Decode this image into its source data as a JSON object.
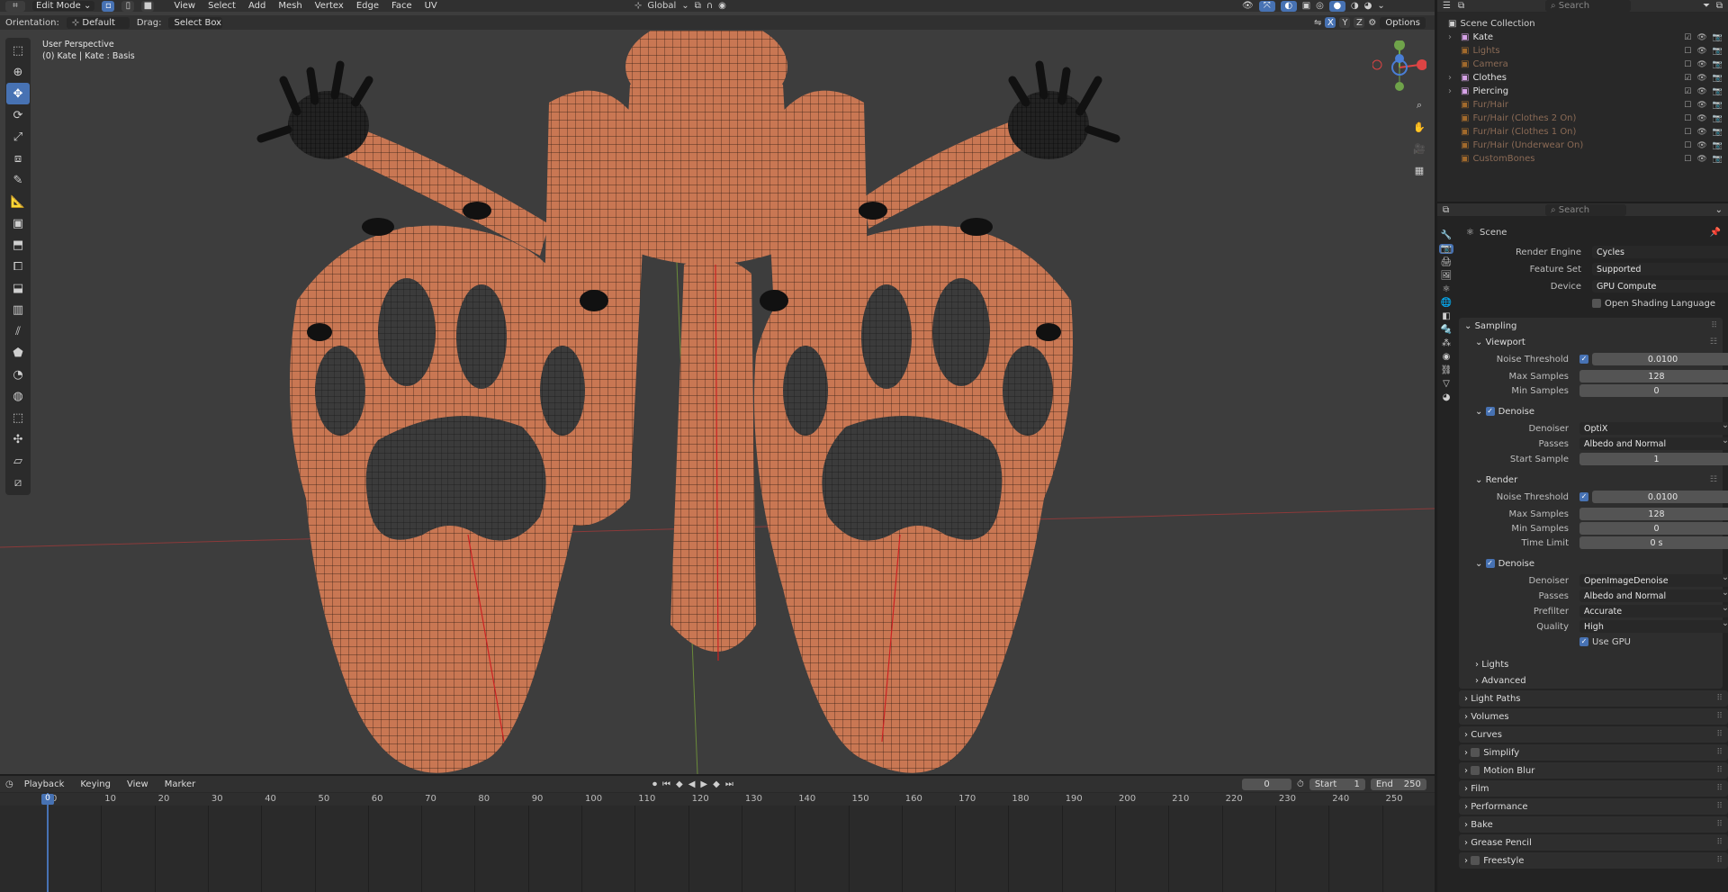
{
  "viewport_header": {
    "mode": "Edit Mode",
    "menus": [
      "View",
      "Select",
      "Add",
      "Mesh",
      "Vertex",
      "Edge",
      "Face",
      "UV"
    ],
    "transform_orientation": "Global",
    "options": "Options",
    "search_placeholder": "Search"
  },
  "tool_settings": {
    "orientation_label": "Orientation:",
    "orientation_value": "Default",
    "drag_label": "Drag:",
    "drag_value": "Select Box"
  },
  "overlay": {
    "perspective": "User Perspective",
    "object_info": "(0) Kate | Kate : Basis"
  },
  "axes": {
    "x": "X",
    "y": "Y",
    "z": "Z"
  },
  "timeline": {
    "menus": [
      "Playback",
      "Keying",
      "View",
      "Marker"
    ],
    "current_frame": "0",
    "start_label": "Start",
    "start": "1",
    "end_label": "End",
    "end": "250",
    "ticks": [
      "0",
      "10",
      "20",
      "30",
      "40",
      "50",
      "60",
      "70",
      "80",
      "90",
      "100",
      "110",
      "120",
      "130",
      "140",
      "150",
      "160",
      "170",
      "180",
      "190",
      "200",
      "210",
      "220",
      "230",
      "240",
      "250"
    ]
  },
  "outliner": {
    "search_placeholder": "Search",
    "root": "Scene Collection",
    "items": [
      {
        "name": "Kate",
        "enabled": true
      },
      {
        "name": "Lights",
        "enabled": false
      },
      {
        "name": "Camera",
        "enabled": false
      },
      {
        "name": "Clothes",
        "enabled": true
      },
      {
        "name": "Piercing",
        "enabled": true
      },
      {
        "name": "Fur/Hair",
        "enabled": false
      },
      {
        "name": "Fur/Hair (Clothes 2 On)",
        "enabled": false
      },
      {
        "name": "Fur/Hair (Clothes 1 On)",
        "enabled": false
      },
      {
        "name": "Fur/Hair (Underwear On)",
        "enabled": false
      },
      {
        "name": "CustomBones",
        "enabled": false
      }
    ]
  },
  "properties": {
    "search_placeholder": "Search",
    "context": "Scene",
    "render_engine_label": "Render Engine",
    "render_engine": "Cycles",
    "feature_set_label": "Feature Set",
    "feature_set": "Supported",
    "device_label": "Device",
    "device": "GPU Compute",
    "osl_label": "Open Shading Language",
    "sampling": "Sampling",
    "viewport": "Viewport",
    "noise_threshold_label": "Noise Threshold",
    "vp_noise_threshold": "0.0100",
    "max_samples_label": "Max Samples",
    "vp_max_samples": "128",
    "min_samples_label": "Min Samples",
    "vp_min_samples": "0",
    "denoise": "Denoise",
    "denoiser_label": "Denoiser",
    "vp_denoiser": "OptiX",
    "passes_label": "Passes",
    "vp_passes": "Albedo and Normal",
    "start_sample_label": "Start Sample",
    "vp_start_sample": "1",
    "render": "Render",
    "r_noise_threshold": "0.0100",
    "r_max_samples": "128",
    "r_min_samples": "0",
    "time_limit_label": "Time Limit",
    "r_time_limit": "0 s",
    "r_denoiser": "OpenImageDenoise",
    "r_passes": "Albedo and Normal",
    "prefilter_label": "Prefilter",
    "r_prefilter": "Accurate",
    "quality_label": "Quality",
    "r_quality": "High",
    "use_gpu_label": "Use GPU",
    "lights": "Lights",
    "advanced": "Advanced",
    "panels": [
      "Light Paths",
      "Volumes",
      "Curves",
      "Simplify",
      "Motion Blur",
      "Film",
      "Performance",
      "Bake",
      "Grease Pencil",
      "Freestyle"
    ]
  }
}
